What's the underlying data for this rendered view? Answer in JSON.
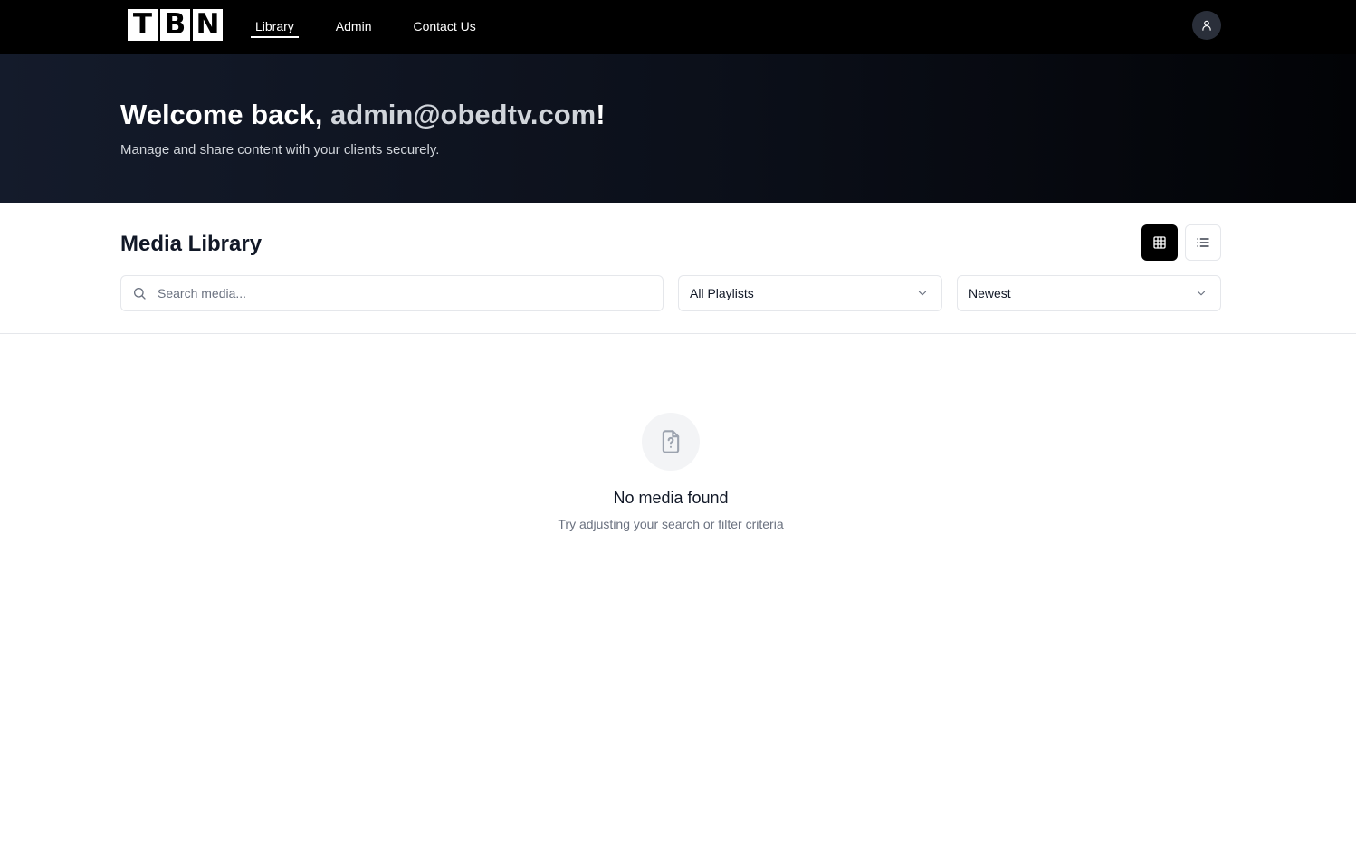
{
  "brand": {
    "letters": [
      "T",
      "B",
      "N"
    ]
  },
  "nav": {
    "items": [
      {
        "label": "Library",
        "active": true
      },
      {
        "label": "Admin",
        "active": false
      },
      {
        "label": "Contact Us",
        "active": false
      }
    ],
    "user_icon": "user-icon"
  },
  "hero": {
    "greeting": "Welcome back, ",
    "email": "admin@obedtv.com",
    "exclaim": "!",
    "subtitle": "Manage and share content with your clients securely."
  },
  "library": {
    "title": "Media Library",
    "view_modes": [
      {
        "icon": "grid-icon",
        "active": true
      },
      {
        "icon": "list-icon",
        "active": false
      }
    ],
    "search": {
      "placeholder": "Search media...",
      "value": ""
    },
    "playlist_filter": {
      "selected": "All Playlists"
    },
    "sort": {
      "selected": "Newest"
    }
  },
  "empty_state": {
    "icon": "file-question-icon",
    "title": "No media found",
    "subtitle": "Try adjusting your search or filter criteria"
  },
  "colors": {
    "topbar": "#000000",
    "hero_start": "#141b2b",
    "hero_end": "#020306",
    "accent_dark": "#000000",
    "muted_text": "#6b7280"
  }
}
